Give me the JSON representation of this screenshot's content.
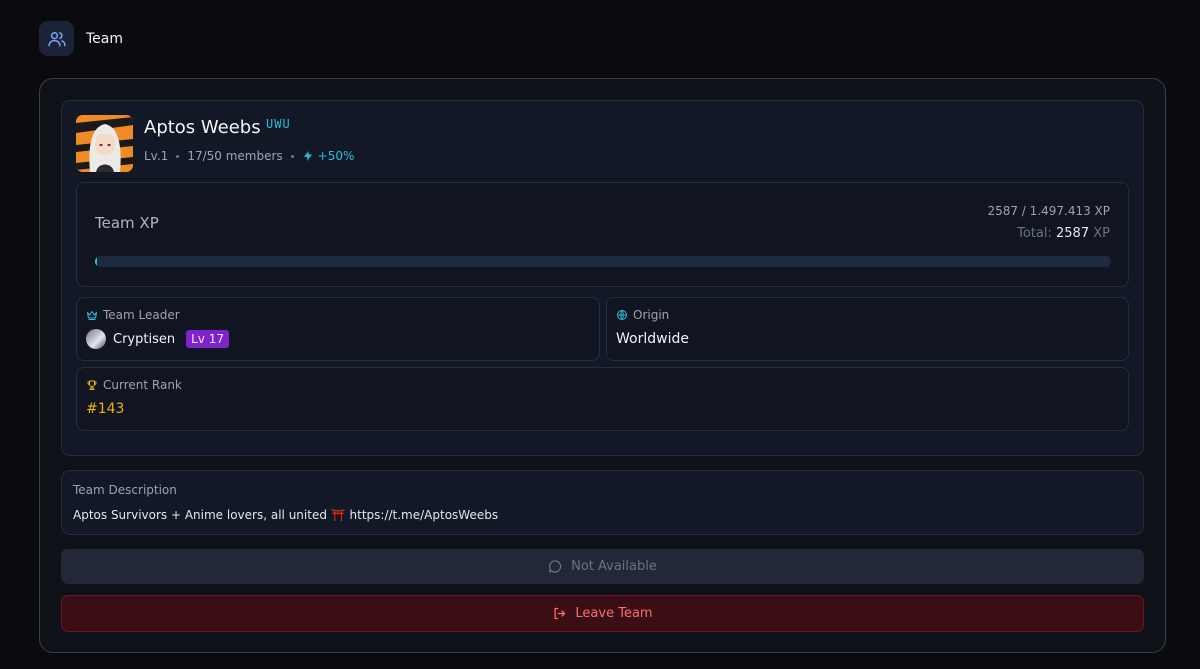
{
  "header": {
    "title": "Team",
    "icon": "users-icon"
  },
  "team": {
    "name": "Aptos Weebs",
    "tag": "UWU",
    "level": "Lv.1",
    "members": "17/50 members",
    "boost": "+50%"
  },
  "xp": {
    "label": "Team XP",
    "progress": "2587 / 1.497.413 XP",
    "total_label": "Total:",
    "total_value": "2587",
    "total_unit": "XP",
    "progress_fraction": 0.0017
  },
  "leader": {
    "label": "Team Leader",
    "name": "Cryptisen",
    "level": "Lv 17",
    "icon": "crown-icon"
  },
  "origin": {
    "label": "Origin",
    "value": "Worldwide",
    "icon": "globe-icon"
  },
  "rank": {
    "label": "Current Rank",
    "value": "#143",
    "icon": "trophy-icon"
  },
  "description": {
    "label": "Team Description",
    "text": "Aptos Survivors + Anime lovers, all united ⛩️ https://t.me/AptosWeebs"
  },
  "buttons": {
    "chat_label": "Not Available",
    "leave_label": "Leave Team"
  },
  "colors": {
    "accent": "#22c0e0",
    "rank": "#eab308",
    "level_badge": "#7e22ce",
    "danger": "#f87171"
  }
}
